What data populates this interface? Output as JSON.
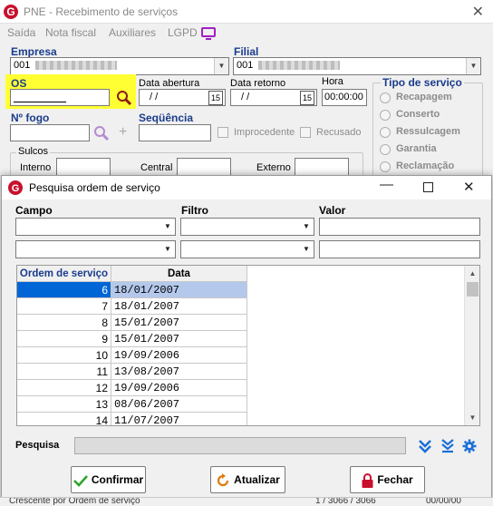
{
  "window": {
    "title": "PNE - Recebimento de serviços",
    "menu": [
      "Saída",
      "Nota fiscal",
      "Auxiliares",
      "LGPD"
    ]
  },
  "form": {
    "empresa_label": "Empresa",
    "empresa_value": "001",
    "filial_label": "Filial",
    "filial_value": "001",
    "os_label": "OS",
    "data_abertura_label": "Data abertura",
    "data_abertura_value": " / /",
    "data_retorno_label": "Data retorno",
    "data_retorno_value": " / /",
    "hora_label": "Hora",
    "hora_value": "00:00:00",
    "nfogo_label": "Nº  fogo",
    "sequencia_label": "Seqüência",
    "improcedente_label": "Improcedente",
    "recusado_label": "Recusado",
    "sulcos_label": "Sulcos",
    "interno_label": "Interno",
    "central_label": "Central",
    "externo_label": "Externo",
    "tipo_servico_label": "Tipo de serviço",
    "tipo_servico_options": [
      "Recapagem",
      "Conserto",
      "Ressulcagem",
      "Garantia",
      "Reclamação"
    ]
  },
  "dialog": {
    "title": "Pesquisa ordem de serviço",
    "campo_label": "Campo",
    "filtro_label": "Filtro",
    "valor_label": "Valor",
    "columns": [
      "Ordem de serviço",
      "Data"
    ],
    "rows": [
      {
        "os": "6",
        "data": "18/01/2007"
      },
      {
        "os": "7",
        "data": "18/01/2007"
      },
      {
        "os": "8",
        "data": "15/01/2007"
      },
      {
        "os": "9",
        "data": "15/01/2007"
      },
      {
        "os": "10",
        "data": "19/09/2006"
      },
      {
        "os": "11",
        "data": "13/08/2007"
      },
      {
        "os": "12",
        "data": "19/09/2006"
      },
      {
        "os": "13",
        "data": "08/06/2007"
      },
      {
        "os": "14",
        "data": "11/07/2007"
      }
    ],
    "selected_row": 0,
    "pesquisa_label": "Pesquisa",
    "confirmar_label": "Confirmar",
    "atualizar_label": "Atualizar",
    "fechar_label": "Fechar"
  },
  "status": {
    "left": "Crescente por Ordem de serviço",
    "middle": "1 / 3066 / 3066",
    "right": "00/00/00"
  },
  "colors": {
    "accent_label": "#1a3c8c",
    "os_highlight": "#ffff33",
    "selection": "#0066d6",
    "app_icon": "#c8102e",
    "monitor_icon": "#a020c0"
  }
}
